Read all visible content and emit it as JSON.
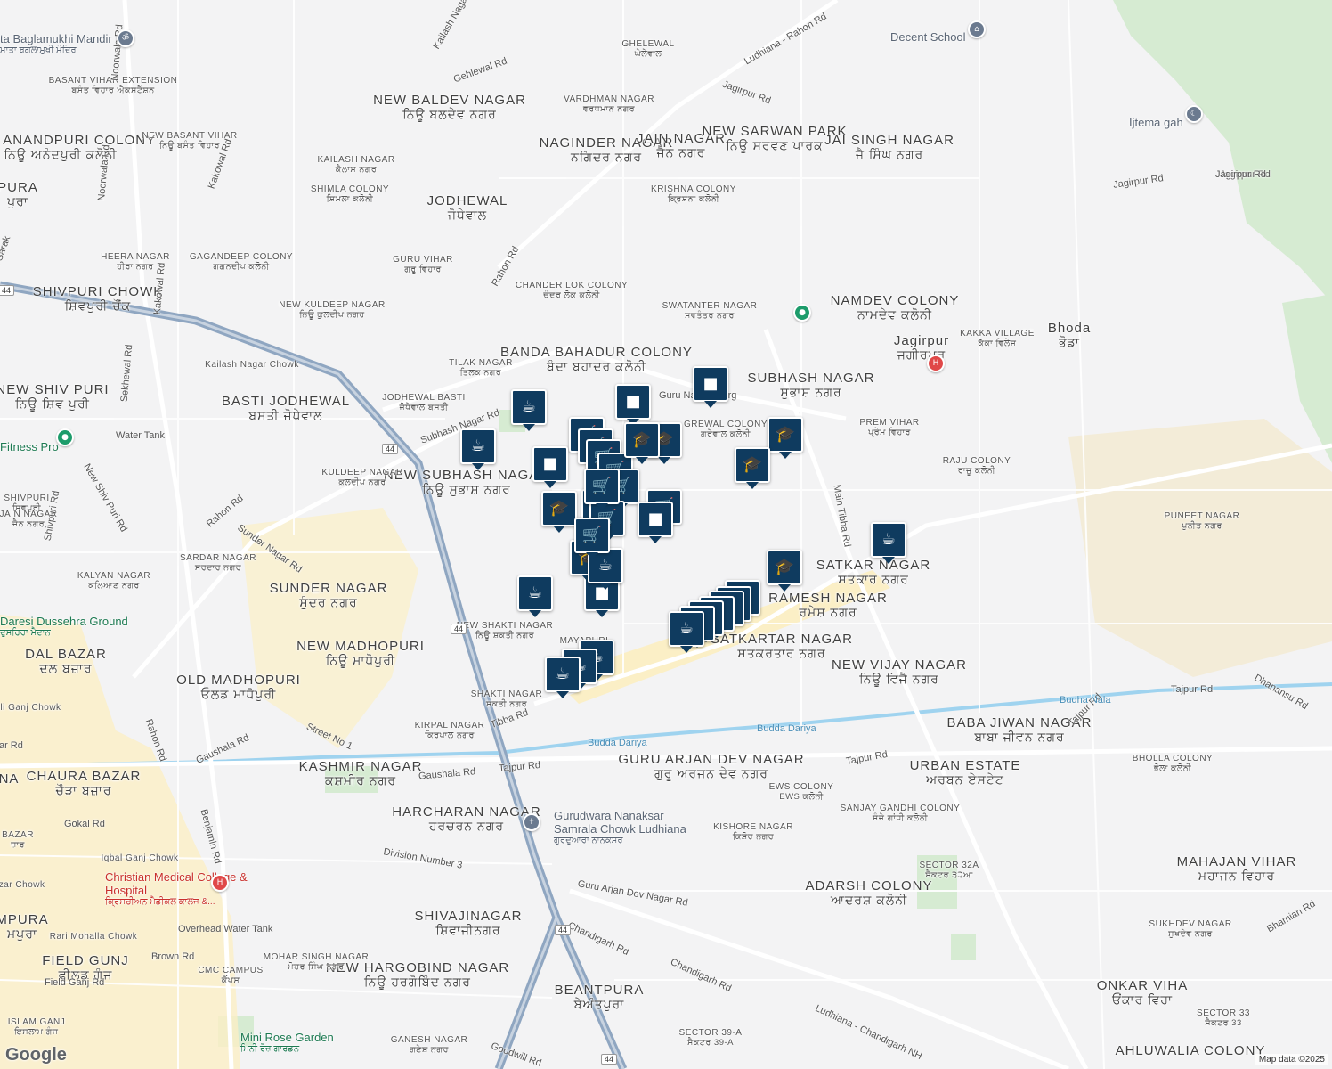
{
  "colors": {
    "land": "#f3f3f4",
    "road_major": "#8fa6c1",
    "road_minor": "#ffffff",
    "park": "#d6ebd2",
    "river": "#9fd3ef",
    "commercial": "#fbefc6",
    "pin": "#0f3b5f",
    "hospital": "#e04848",
    "poi_green": "#1d9c6b"
  },
  "localities": [
    {
      "en": "NEW BALDEV NAGAR",
      "pa": "ਨਿਊ ਬਲਦੇਵ ਨਗਰ",
      "size": "big"
    },
    {
      "en": "GHELEWAL",
      "pa": "ਘੇਲੇਵਾਲ",
      "size": "small"
    },
    {
      "en": "VARDHMAN NAGAR",
      "pa": "ਵਰਧਮਾਨ ਨਗਰ",
      "size": "small"
    },
    {
      "en": "NAGINDER NAGAR",
      "pa": "ਨਗਿੰਦਰ ਨਗਰ",
      "size": "big"
    },
    {
      "en": "JAIN NAGAR",
      "pa": "ਜੈਨ ਨਗਰ",
      "size": "big"
    },
    {
      "en": "NEW SARWAN PARK",
      "pa": "ਨਿਊ ਸਰਵਣ ਪਾਰਕ",
      "size": "big"
    },
    {
      "en": "JAI SINGH NAGAR",
      "pa": "ਜੈ ਸਿੰਘ ਨਗਰ",
      "size": "big"
    },
    {
      "en": "NEW ANANDPURI COLONY",
      "pa": "ਨਿਊ ਅਨੰਦਪੁਰੀ ਕਲੋਨੀ",
      "size": "big"
    },
    {
      "en": "BASANT VIHAR EXTENSION",
      "pa": "ਬਸੰਤ ਵਿਹਾਰ ਐਕਸਟੈਂਸ਼ਨ",
      "size": "small"
    },
    {
      "en": "NEW BASANT VIHAR",
      "pa": "ਨਿਊ ਬਸੰਤ ਵਿਹਾਰ",
      "size": "small"
    },
    {
      "en": "KAILASH NAGAR",
      "pa": "ਕੈਲਾਸ਼ ਨਗਰ",
      "size": "small"
    },
    {
      "en": "SHIMLA COLONY",
      "pa": "ਸ਼ਿਮਲਾ ਕਲੋਨੀ",
      "size": "small"
    },
    {
      "en": "KRISHNA COLONY",
      "pa": "ਕ੍ਰਿਸ਼ਨਾ ਕਲੋਨੀ",
      "size": "small"
    },
    {
      "en": "JODHEWAL",
      "pa": "ਜੋਧੇਵਾਲ",
      "size": "big"
    },
    {
      "en": "HEERA NAGAR",
      "pa": "ਹੀਰਾ ਨਗਰ",
      "size": "small"
    },
    {
      "en": "GURU VIHAR",
      "pa": "ਗੁਰੂ ਵਿਹਾਰ",
      "size": "small"
    },
    {
      "en": "SHIVPURI CHOWK",
      "pa": "ਸ਼ਿਵਪੁਰੀ ਚੌਂਕ",
      "size": "big"
    },
    {
      "en": "GAGANDEEP COLONY",
      "pa": "ਗਗਨਦੀਪ ਕਲੋਨੀ",
      "size": "small"
    },
    {
      "en": "NEW KULDEEP NAGAR",
      "pa": "ਨਿਊ ਕੁਲਦੀਪ ਨਗਰ",
      "size": "small"
    },
    {
      "en": "CHANDER LOK COLONY",
      "pa": "ਚੰਦਰ ਲੋਕ ਕਲੋਨੀ",
      "size": "small"
    },
    {
      "en": "SWATANTER NAGAR",
      "pa": "ਸਵਤੰਤਰ ਨਗਰ",
      "size": "small"
    },
    {
      "en": "NAMDEV COLONY",
      "pa": "ਨਾਮਦੇਵ ਕਲੋਨੀ",
      "size": "big"
    },
    {
      "en": "BANDA BAHADUR COLONY",
      "pa": "ਬੰਦਾ ਬਹਾਦਰ ਕਲੋਨੀ",
      "size": "big"
    },
    {
      "en": "TILAK NAGAR",
      "pa": "ਤਿਲਕ ਨਗਰ",
      "size": "small"
    },
    {
      "en": "SUBHASH NAGAR",
      "pa": "ਸੁਭਾਸ਼ ਨਗਰ",
      "size": "big"
    },
    {
      "en": "NEW SHIV PURI",
      "pa": "ਨਿਊ ਸ਼ਿਵ ਪੁਰੀ",
      "size": "big"
    },
    {
      "en": "BASTI JODHEWAL",
      "pa": "ਬਸਤੀ ਜੋਧੇਵਾਲ",
      "size": "big"
    },
    {
      "en": "JODHEWAL BASTI",
      "pa": "ਜੋਧੇਵਾਲ ਬਸਤੀ",
      "size": "small"
    },
    {
      "en": "PREM VIHAR",
      "pa": "ਪ੍ਰੇਮ ਵਿਹਾਰ",
      "size": "small"
    },
    {
      "en": "GREWAL COLONY",
      "pa": "ਗਰੇਵਾਲ ਕਲੋਨੀ",
      "size": "small"
    },
    {
      "en": "NEW SUBHASH NAGAR",
      "pa": "ਨਿਊ ਸੁਭਾਸ਼ ਨਗਰ",
      "size": "big"
    },
    {
      "en": "KULDEEP NAGAR",
      "pa": "ਕੁਲਦੀਪ ਨਗਰ",
      "size": "small"
    },
    {
      "en": "RAJU COLONY",
      "pa": "ਰਾਜੂ ਕਲੋਨੀ",
      "size": "small"
    },
    {
      "en": "SHIVPURI",
      "pa": "ਸ਼ਿਵਪੁਰੀ",
      "size": "small"
    },
    {
      "en": "JAIN NAGAR",
      "pa": "ਜੈਨ ਨਗਰ",
      "size": "small"
    },
    {
      "en": "PUNEET NAGAR",
      "pa": "ਪੁਨੀਤ ਨਗਰ",
      "size": "small"
    },
    {
      "en": "SARDAR NAGAR",
      "pa": "ਸਰਦਾਰ ਨਗਰ",
      "size": "small"
    },
    {
      "en": "SATKAR NAGAR",
      "pa": "ਸਤਕਾਰ ਨਗਰ",
      "size": "big"
    },
    {
      "en": "KALYAN NAGAR",
      "pa": "ਕਲਿਆਣ ਨਗਰ",
      "size": "small"
    },
    {
      "en": "SUNDER NAGAR",
      "pa": "ਸੁੰਦਰ ਨਗਰ",
      "size": "big"
    },
    {
      "en": "RAMESH NAGAR",
      "pa": "ਰਮੇਸ਼ ਨਗਰ",
      "size": "big"
    },
    {
      "en": "NEW SHAKTI NAGAR",
      "pa": "ਨਿਊ ਸ਼ਕਤੀ ਨਗਰ",
      "size": "small"
    },
    {
      "en": "NEW MADHOPURI",
      "pa": "ਨਿਊ ਮਾਧੋਪੁਰੀ",
      "size": "big"
    },
    {
      "en": "SATKARTAR NAGAR",
      "pa": "ਸਤਕਰਤਾਰ ਨਗਰ",
      "size": "big"
    },
    {
      "en": "DAL BAZAR",
      "pa": "ਦਲ ਬਜ਼ਾਰ",
      "size": "big"
    },
    {
      "en": "NEW VIJAY NAGAR",
      "pa": "ਨਿਊ ਵਿਜੈ ਨਗਰ",
      "size": "big"
    },
    {
      "en": "OLD MADHOPURI",
      "pa": "ਓਲਡ ਮਾਧੋਪੁਰੀ",
      "size": "big"
    },
    {
      "en": "SHAKTI NAGAR",
      "pa": "ਸ਼ਕਤੀ ਨਗਰ",
      "size": "small"
    },
    {
      "en": "KIRPAL NAGAR",
      "pa": "ਕਿਰਪਾਲ ਨਗਰ",
      "size": "small"
    },
    {
      "en": "BABA JIWAN NAGAR",
      "pa": "ਬਾਬਾ ਜੀਵਨ ਨਗਰ",
      "size": "big"
    },
    {
      "en": "GURU ARJAN DEV NAGAR",
      "pa": "ਗੁਰੂ ਅਰਜਨ ਦੇਵ ਨਗਰ",
      "size": "big"
    },
    {
      "en": "URBAN ESTATE",
      "pa": "ਅਰਬਨ ਏਸਟੇਟ",
      "size": "big"
    },
    {
      "en": "KASHMIR NAGAR",
      "pa": "ਕਸ਼ਮੀਰ ਨਗਰ",
      "size": "big"
    },
    {
      "en": "CHAURA BAZAR",
      "pa": "ਚੌੜਾ ਬਜ਼ਾਰ",
      "size": "big"
    },
    {
      "en": "BHOLLA COLONY",
      "pa": "ਭੋਲਾ ਕਲੋਨੀ",
      "size": "small"
    },
    {
      "en": "EWS COLONY",
      "pa": "EWS ਕਲੋਨੀ",
      "size": "small"
    },
    {
      "en": "SANJAY GANDHI COLONY",
      "pa": "ਸੰਜੇ ਗਾਂਧੀ ਕਲੋਨੀ",
      "size": "small"
    },
    {
      "en": "HARCHARAN NAGAR",
      "pa": "ਹਰਚਰਨ ਨਗਰ",
      "size": "big"
    },
    {
      "en": "KISHORE NAGAR",
      "pa": "ਕਿਸ਼ੋਰ ਨਗਰ",
      "size": "small"
    },
    {
      "en": "SECTOR 32A",
      "pa": "ਸੈਕਟਰ ੩੨ਆ",
      "size": "small"
    },
    {
      "en": "MAHAJAN VIHAR",
      "pa": "ਮਹਾਜਨ ਵਿਹਾਰ",
      "size": "big"
    },
    {
      "en": "ADARSH COLONY",
      "pa": "ਆਦਰਸ਼ ਕਲੋਨੀ",
      "size": "big"
    },
    {
      "en": "SHIVAJINAGAR",
      "pa": "ਸ਼ਿਵਾਜੀਨਗਰ",
      "size": "big"
    },
    {
      "en": "SUKHDEV NAGAR",
      "pa": "ਸੁਖਦੇਵ ਨਗਰ",
      "size": "small"
    },
    {
      "en": "NEW HARGOBIND NAGAR",
      "pa": "ਨਿਊ ਹਰਗੋਬਿੰਦ ਨਗਰ",
      "size": "big"
    },
    {
      "en": "FIELD GUNJ",
      "pa": "ਫੀਲਡ ਗੰਜ",
      "size": "big"
    },
    {
      "en": "MOHAR SINGH NAGAR",
      "pa": "ਮੋਹਰ ਸਿੰਘ ਨਗਰ",
      "size": "small"
    },
    {
      "en": "CMC CAMPUS",
      "pa": "ਕੈਂਪਸ",
      "size": "small"
    },
    {
      "en": "BEANTPURA",
      "pa": "ਬੇਅੰਤਪੁਰਾ",
      "size": "big"
    },
    {
      "en": "ONKAR VIHA",
      "pa": "ਓਂਕਾਰ ਵਿਹਾ",
      "size": "big"
    },
    {
      "en": "SECTOR 33",
      "pa": "ਸੈਕਟਰ 33",
      "size": "small"
    },
    {
      "en": "AHLUWALIA COLONY",
      "pa": "",
      "size": "big"
    },
    {
      "en": "GANESH NAGAR",
      "pa": "ਗਣੇਸ਼ ਨਗਰ",
      "size": "small"
    },
    {
      "en": "SECTOR 39-A",
      "pa": "ਸੈਕਟਰ 39-A",
      "size": "small"
    },
    {
      "en": "ISLAM GANJ",
      "pa": "ਇਸਲਾਮ ਗੰਜ",
      "size": "small"
    },
    {
      "en": "Rari Mohalla Chowk",
      "pa": "",
      "size": "small"
    },
    {
      "en": "Iqbal Ganj Chowk",
      "pa": "",
      "size": "small"
    },
    {
      "en": "Mali Ganj Chowk",
      "pa": "",
      "size": "small"
    },
    {
      "en": "Kailash Nagar Chowk",
      "pa": "",
      "size": "small"
    },
    {
      "en": "MAYAPURI",
      "pa": "",
      "size": "small"
    },
    {
      "en": "Bhoda",
      "pa": "ਭੋਡਾ",
      "size": "big"
    },
    {
      "en": "KAKKA VILLAGE",
      "pa": "ਕੱਕਾ ਵਿਲੇਜ",
      "size": "small"
    },
    {
      "en": "Jagirpur",
      "pa": "ਜਗੀਰਪੁਰ",
      "size": "big"
    },
    {
      "en": "PURA",
      "pa": "ਪੁਰਾ",
      "size": "big"
    },
    {
      "en": "MPURA",
      "pa": "ਮਪੁਰਾ",
      "size": "big"
    },
    {
      "en": "NA",
      "pa": "",
      "size": "big"
    },
    {
      "en": "BAZAR",
      "pa": "ਜ਼ਾਰ",
      "size": "small"
    },
    {
      "en": "Bazar Chowk",
      "pa": "",
      "size": "small"
    }
  ],
  "roads": [
    "Kailash Nagar Rd",
    "Ludhiana - Rahon Rd",
    "Gehlewal Rd",
    "Noorwala Rd",
    "Jagirpur Rd",
    "Jagirpur Rd",
    "Jagirpur Rd",
    "Kakowal Rd",
    "Noorwala Rd",
    "Kali Sarak",
    "Rahon Rd",
    "Kakowal Rd",
    "Sekhewal Rd",
    "Guru Nanak Marg",
    "Subhash Nagar Rd",
    "New Shiv Puri Rd",
    "Shivpuri Rd",
    "Rahon Rd",
    "Sunder Nagar Rd",
    "Main Tibba Rd",
    "Tibba Rd",
    "Street No 1",
    "Rahon Rd",
    "Gaushala Rd",
    "Gaushala Rd",
    "Tajpur Rd",
    "Tajpur Rd",
    "Tajpur Rd",
    "Tajpur Rd",
    "Benjamin Rd",
    "Gokal Rd",
    "Division Number 3",
    "Guru Arjan Dev Nagar Rd",
    "Chandigarh Rd",
    "Chandigarh Rd",
    "Ludhiana - Chandigarh NH",
    "Brown Rd",
    "Field Ganj Rd",
    "Goodwill Rd",
    "Bhamian Rd",
    "Dhanansu Rd",
    "Bazar Rd",
    "Jagirpur Rd"
  ],
  "water": [
    "Budha Nala",
    "Budda Dariya",
    "Budda Dariya",
    "Water Tank",
    "Overhead Water Tank"
  ],
  "places": [
    {
      "name": "Decent School",
      "icon": "school-icon"
    },
    {
      "name": "Ijtema gah",
      "icon": "mosque-icon"
    },
    {
      "name": "Fitness Pro",
      "icon": "gym-icon"
    },
    {
      "name": "Gurudwara Nanaksar Samrala Chowk Ludhiana",
      "sub": "ਗੁਰਦੁਆਰਾ ਨਾਨਕਸਰ",
      "icon": "worship-icon"
    },
    {
      "name": "Christian Medical College & Hospital",
      "sub": "ਕ੍ਰਿਸਚੀਅਨ ਮੈਡੀਕਲ ਕਾਲਜ &...",
      "icon": "hospital-icon"
    },
    {
      "name": "ta Baglamukhi Mandir",
      "sub": "ਮਾਤਾ ਬਗਲਾਮੁਖੀ ਮੰਦਿਰ",
      "icon": "temple-icon"
    },
    {
      "name": "Mini Rose Garden",
      "sub": "ਮਿਨੀ ਰੋਜ਼ ਗਾਰਡਨ",
      "icon": "park-icon"
    },
    {
      "name": "Daresi Dussehra Ground",
      "sub": "ਦੁਸਹਿਰਾ ਮੈਦਾਨ",
      "icon": "park-icon"
    }
  ],
  "highway_shield": "44",
  "markers": [
    "coffee",
    "shopping-bag",
    "cart",
    "shopping-bag",
    "school",
    "school",
    "cart",
    "cart",
    "cart",
    "cart",
    "coffee",
    "shopping-bag",
    "school",
    "cart",
    "cart",
    "cart",
    "shopping-bag",
    "shopping-bag",
    "coffee",
    "school",
    "coffee",
    "shopping-bag",
    "coffee",
    "restaurant",
    "restaurant",
    "restaurant",
    "coffee",
    "coffee",
    "coffee",
    "coffee",
    "school",
    "school",
    "coffee",
    "school",
    "cart",
    "cart",
    "coffee"
  ],
  "attribution": "Map data ©2025",
  "logo": "Google"
}
